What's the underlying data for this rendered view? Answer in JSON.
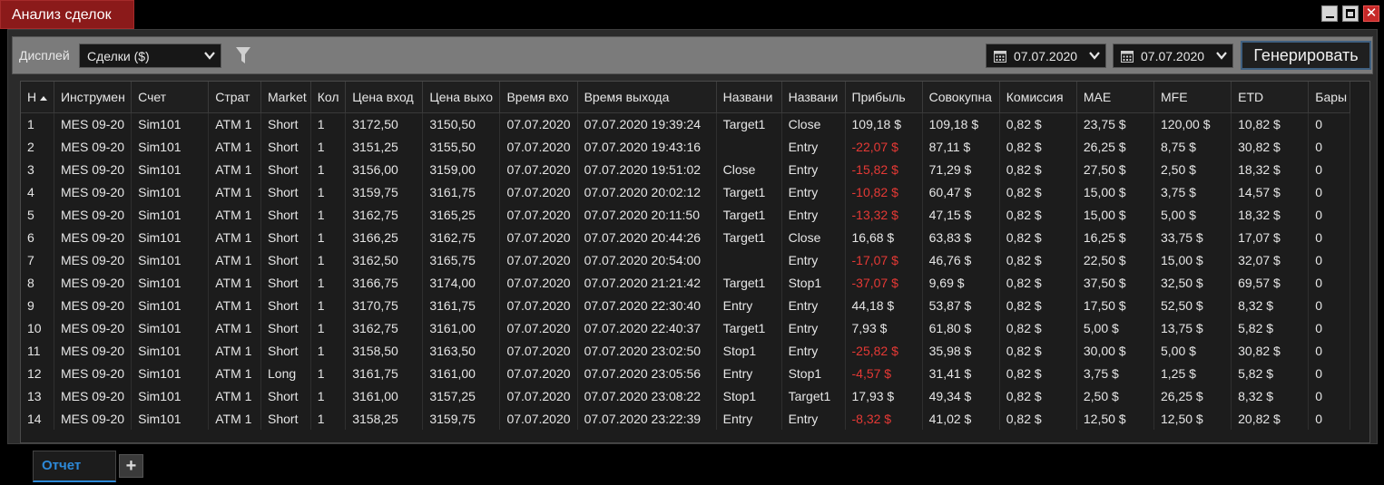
{
  "window": {
    "title": "Анализ сделок"
  },
  "toolbar": {
    "display_label": "Дисплей",
    "display_value": "Сделки ($)",
    "date_from": "07.07.2020",
    "date_to": "07.07.2020",
    "generate_label": "Генерировать"
  },
  "table": {
    "columns": [
      "Н",
      "Инструмен",
      "Счет",
      "Страт",
      "Market",
      "Кол",
      "Цена вход",
      "Цена выхо",
      "Время вхо",
      "Время выхода",
      "Названи",
      "Названи",
      "Прибыль",
      "Совокупна",
      "Комиссия",
      "MAE",
      "MFE",
      "ETD",
      "Бары"
    ],
    "rows": [
      [
        "1",
        "MES 09-20",
        "Sim101",
        "ATM 1",
        "Short",
        "1",
        "3172,50",
        "3150,50",
        "07.07.2020",
        "07.07.2020 19:39:24",
        "Target1",
        "Close",
        "109,18 $",
        "109,18 $",
        "0,82 $",
        "23,75 $",
        "120,00 $",
        "10,82 $",
        "0"
      ],
      [
        "2",
        "MES 09-20",
        "Sim101",
        "ATM 1",
        "Short",
        "1",
        "3151,25",
        "3155,50",
        "07.07.2020",
        "07.07.2020 19:43:16",
        "",
        "Entry",
        "-22,07 $",
        "87,11 $",
        "0,82 $",
        "26,25 $",
        "8,75 $",
        "30,82 $",
        "0"
      ],
      [
        "3",
        "MES 09-20",
        "Sim101",
        "ATM 1",
        "Short",
        "1",
        "3156,00",
        "3159,00",
        "07.07.2020",
        "07.07.2020 19:51:02",
        "Close",
        "Entry",
        "-15,82 $",
        "71,29 $",
        "0,82 $",
        "27,50 $",
        "2,50 $",
        "18,32 $",
        "0"
      ],
      [
        "4",
        "MES 09-20",
        "Sim101",
        "ATM 1",
        "Short",
        "1",
        "3159,75",
        "3161,75",
        "07.07.2020",
        "07.07.2020 20:02:12",
        "Target1",
        "Entry",
        "-10,82 $",
        "60,47 $",
        "0,82 $",
        "15,00 $",
        "3,75 $",
        "14,57 $",
        "0"
      ],
      [
        "5",
        "MES 09-20",
        "Sim101",
        "ATM 1",
        "Short",
        "1",
        "3162,75",
        "3165,25",
        "07.07.2020",
        "07.07.2020 20:11:50",
        "Target1",
        "Entry",
        "-13,32 $",
        "47,15 $",
        "0,82 $",
        "15,00 $",
        "5,00 $",
        "18,32 $",
        "0"
      ],
      [
        "6",
        "MES 09-20",
        "Sim101",
        "ATM 1",
        "Short",
        "1",
        "3166,25",
        "3162,75",
        "07.07.2020",
        "07.07.2020 20:44:26",
        "Target1",
        "Close",
        "16,68 $",
        "63,83 $",
        "0,82 $",
        "16,25 $",
        "33,75 $",
        "17,07 $",
        "0"
      ],
      [
        "7",
        "MES 09-20",
        "Sim101",
        "ATM 1",
        "Short",
        "1",
        "3162,50",
        "3165,75",
        "07.07.2020",
        "07.07.2020 20:54:00",
        "",
        "Entry",
        "-17,07 $",
        "46,76 $",
        "0,82 $",
        "22,50 $",
        "15,00 $",
        "32,07 $",
        "0"
      ],
      [
        "8",
        "MES 09-20",
        "Sim101",
        "ATM 1",
        "Short",
        "1",
        "3166,75",
        "3174,00",
        "07.07.2020",
        "07.07.2020 21:21:42",
        "Target1",
        "Stop1",
        "-37,07 $",
        "9,69 $",
        "0,82 $",
        "37,50 $",
        "32,50 $",
        "69,57 $",
        "0"
      ],
      [
        "9",
        "MES 09-20",
        "Sim101",
        "ATM 1",
        "Short",
        "1",
        "3170,75",
        "3161,75",
        "07.07.2020",
        "07.07.2020 22:30:40",
        "Entry",
        "Entry",
        "44,18 $",
        "53,87 $",
        "0,82 $",
        "17,50 $",
        "52,50 $",
        "8,32 $",
        "0"
      ],
      [
        "10",
        "MES 09-20",
        "Sim101",
        "ATM 1",
        "Short",
        "1",
        "3162,75",
        "3161,00",
        "07.07.2020",
        "07.07.2020 22:40:37",
        "Target1",
        "Entry",
        "7,93 $",
        "61,80 $",
        "0,82 $",
        "5,00 $",
        "13,75 $",
        "5,82 $",
        "0"
      ],
      [
        "11",
        "MES 09-20",
        "Sim101",
        "ATM 1",
        "Short",
        "1",
        "3158,50",
        "3163,50",
        "07.07.2020",
        "07.07.2020 23:02:50",
        "Stop1",
        "Entry",
        "-25,82 $",
        "35,98 $",
        "0,82 $",
        "30,00 $",
        "5,00 $",
        "30,82 $",
        "0"
      ],
      [
        "12",
        "MES 09-20",
        "Sim101",
        "ATM 1",
        "Long",
        "1",
        "3161,75",
        "3161,00",
        "07.07.2020",
        "07.07.2020 23:05:56",
        "Entry",
        "Stop1",
        "-4,57 $",
        "31,41 $",
        "0,82 $",
        "3,75 $",
        "1,25 $",
        "5,82 $",
        "0"
      ],
      [
        "13",
        "MES 09-20",
        "Sim101",
        "ATM 1",
        "Short",
        "1",
        "3161,00",
        "3157,25",
        "07.07.2020",
        "07.07.2020 23:08:22",
        "Stop1",
        "Target1",
        "17,93 $",
        "49,34 $",
        "0,82 $",
        "2,50 $",
        "26,25 $",
        "8,32 $",
        "0"
      ],
      [
        "14",
        "MES 09-20",
        "Sim101",
        "ATM 1",
        "Short",
        "1",
        "3158,25",
        "3159,75",
        "07.07.2020",
        "07.07.2020 23:22:39",
        "Entry",
        "Entry",
        "-8,32 $",
        "41,02 $",
        "0,82 $",
        "12,50 $",
        "12,50 $",
        "20,82 $",
        "0"
      ]
    ]
  },
  "tabs": {
    "active_label": "Отчет",
    "add_label": "+"
  },
  "colors": {
    "title_bg": "#8b1a1a",
    "negative": "#e53935",
    "tab_accent": "#2d89d8",
    "toolbar_bg": "#7b7b7b"
  },
  "icons": {
    "filter": "filter-icon",
    "calendar": "calendar-icon",
    "dropdown": "chevron-down-icon",
    "minimize": "minimize-icon",
    "maximize": "maximize-icon",
    "close": "close-icon",
    "sort": "sort-ascending-icon"
  }
}
